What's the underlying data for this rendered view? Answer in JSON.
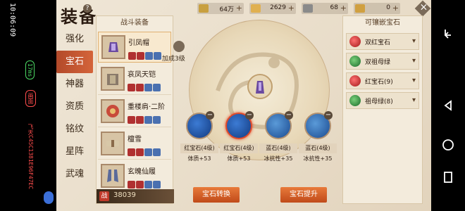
{
  "system": {
    "time": "10:06:09",
    "fps": "17ms",
    "device": "画面",
    "id": "飞天C45C1381E96F47EC"
  },
  "title": "装备",
  "tabs": [
    "强化",
    "宝石",
    "神器",
    "资质",
    "铭纹",
    "星阵",
    "武魂"
  ],
  "active_tab": 1,
  "equip_header": "战斗装备",
  "equipment": [
    {
      "name": "引凤帽"
    },
    {
      "name": "哀凤天铠"
    },
    {
      "name": "重楼肩·二阶"
    },
    {
      "name": "檀雪"
    },
    {
      "name": "玄魄仙履"
    }
  ],
  "power": {
    "label": "战",
    "value": "38039"
  },
  "currency": [
    {
      "value": "64万"
    },
    {
      "value": "2629"
    },
    {
      "value": "68"
    },
    {
      "value": "0"
    }
  ],
  "level_up_text": "加成3级",
  "slots": [
    {
      "name": "红宝石(4级)",
      "stat": "体质+53"
    },
    {
      "name": "红宝石(4级)",
      "stat": "体质+53"
    },
    {
      "name": "蓝石(4级)",
      "stat": "冰抗性+35"
    },
    {
      "name": "蓝石(4级)",
      "stat": "冰抗性+35"
    }
  ],
  "buttons": {
    "convert": "宝石转换",
    "upgrade": "宝石提升"
  },
  "inlay_header": "可镶嵌宝石",
  "inlay_items": [
    {
      "name": "双红宝石",
      "color": "red"
    },
    {
      "name": "双祖母绿",
      "color": "green"
    },
    {
      "name": "红宝石(9)",
      "color": "red"
    },
    {
      "name": "祖母绿(8)",
      "color": "green"
    }
  ]
}
